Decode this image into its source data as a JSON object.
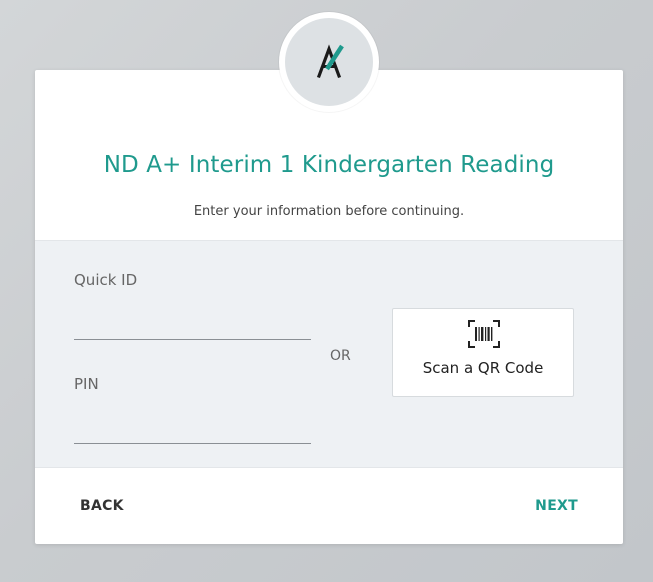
{
  "colors": {
    "accent": "#1f9a8d",
    "background": "#cfd3d6",
    "card": "#ffffff",
    "panel": "#eef1f4"
  },
  "logo": {
    "icon": "a-plus-logo-icon",
    "letter": "A"
  },
  "header": {
    "title": "ND A+ Interim 1 Kindergarten Reading",
    "subtitle": "Enter your information before continuing."
  },
  "form": {
    "quick_id_label": "Quick ID",
    "quick_id_value": "",
    "pin_label": "PIN",
    "pin_value": "",
    "or_text": "OR",
    "qr_icon": "barcode-scan-icon",
    "qr_button_label": "Scan a QR Code"
  },
  "footer": {
    "back_label": "BACK",
    "next_label": "NEXT"
  }
}
